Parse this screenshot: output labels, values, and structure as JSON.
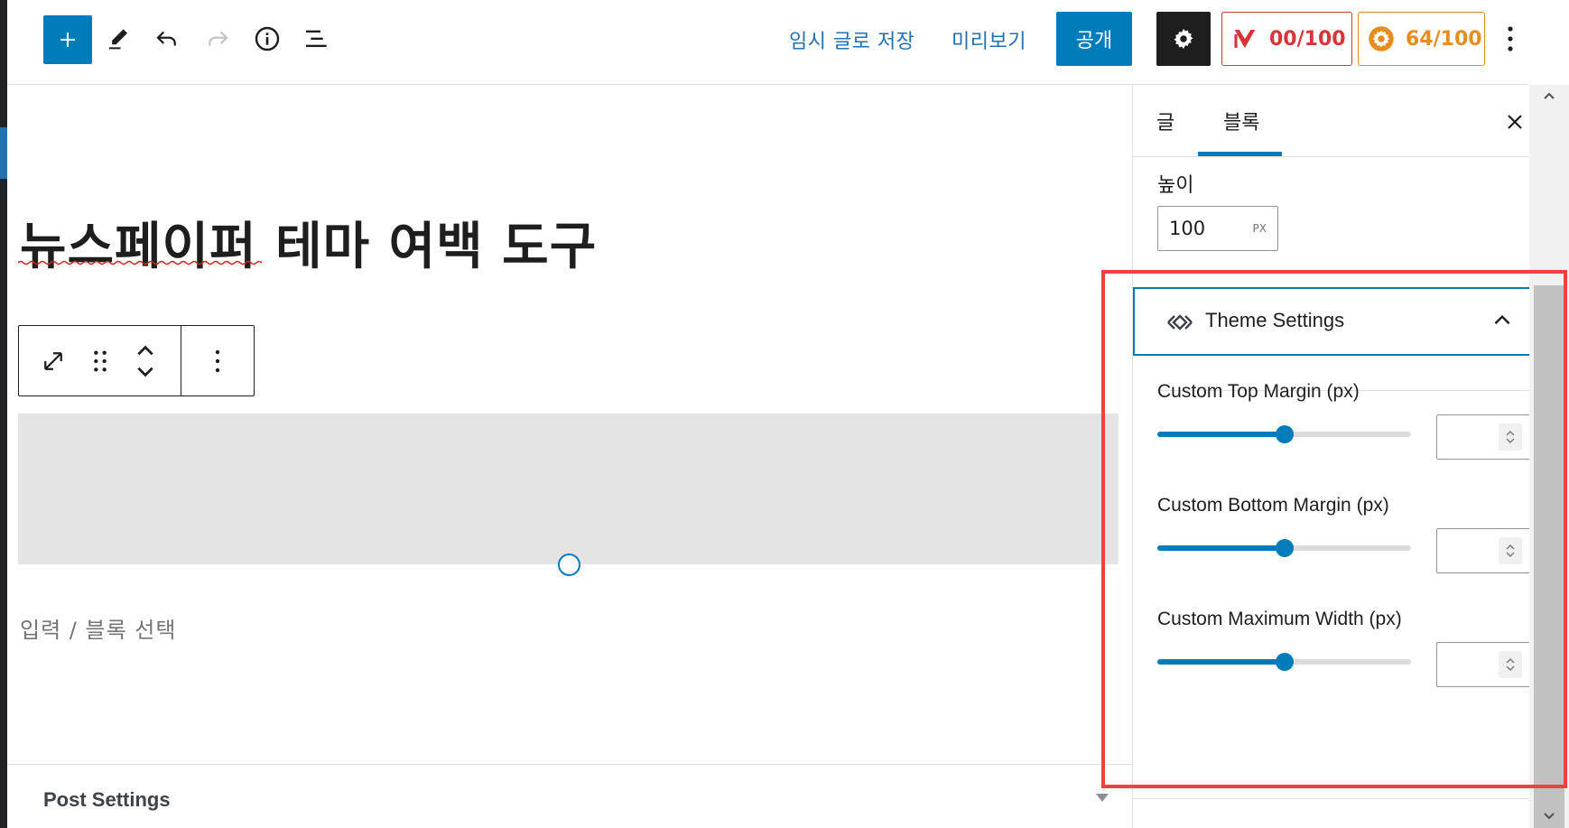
{
  "toolbar": {
    "add_icon": "plus-icon",
    "tools_icon": "pencil-icon",
    "undo_icon": "undo-icon",
    "redo_icon": "redo-icon",
    "info_icon": "info-icon",
    "list_view_icon": "list-view-icon",
    "save_draft_label": "임시 글로 저장",
    "preview_label": "미리보기",
    "publish_label": "공개",
    "settings_icon": "gear-icon",
    "yoast_score": "00/100",
    "rank_score": "64/100",
    "more_icon": "vertical-ellipsis-icon",
    "accent_color": "#007cba",
    "yoast_color": "#d63638",
    "rank_color": "#e78d1e"
  },
  "editor": {
    "post_title": "뉴스페이퍼 테마 여백 도구",
    "block_placeholder": "입력 / 블록 선택",
    "post_settings_label": "Post Settings",
    "block_toolbar": {
      "icons": [
        "resize-icon",
        "drag-handle-icon",
        "move-up-down-icon",
        "block-options-icon"
      ]
    }
  },
  "sidebar": {
    "tabs": [
      {
        "label": "글",
        "active": false
      },
      {
        "label": "블록",
        "active": true
      }
    ],
    "close_icon": "close-icon",
    "height_label": "높이",
    "height_value": "100",
    "height_unit": "PX",
    "theme_settings": {
      "title": "Theme Settings",
      "expanded": true,
      "controls": [
        {
          "label": "Custom Top Margin (px)",
          "slider_fraction": 0.5,
          "value": ""
        },
        {
          "label": "Custom Bottom Margin (px)",
          "slider_fraction": 0.5,
          "value": ""
        },
        {
          "label": "Custom Maximum Width (px)",
          "slider_fraction": 0.5,
          "value": ""
        }
      ]
    }
  }
}
